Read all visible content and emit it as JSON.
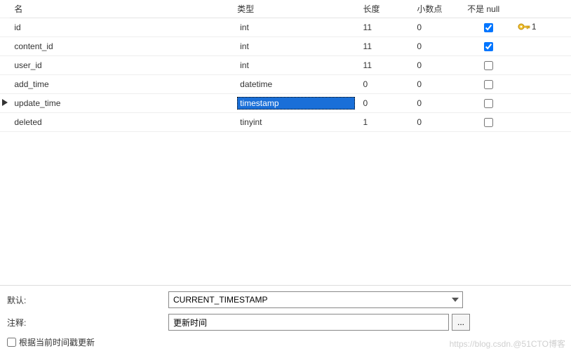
{
  "table": {
    "headers": {
      "name": "名",
      "type": "类型",
      "length": "长度",
      "decimals": "小数点",
      "notnull": "不是 null"
    },
    "rows": [
      {
        "name": "id",
        "type": "int",
        "length": "11",
        "decimals": "0",
        "notnull": true,
        "selected": false,
        "active": false,
        "pk": "1"
      },
      {
        "name": "content_id",
        "type": "int",
        "length": "11",
        "decimals": "0",
        "notnull": true,
        "selected": false,
        "active": false,
        "pk": ""
      },
      {
        "name": "user_id",
        "type": "int",
        "length": "11",
        "decimals": "0",
        "notnull": false,
        "selected": false,
        "active": false,
        "pk": ""
      },
      {
        "name": "add_time",
        "type": "datetime",
        "length": "0",
        "decimals": "0",
        "notnull": false,
        "selected": false,
        "active": false,
        "pk": ""
      },
      {
        "name": "update_time",
        "type": "timestamp",
        "length": "0",
        "decimals": "0",
        "notnull": false,
        "selected": true,
        "active": true,
        "pk": ""
      },
      {
        "name": "deleted",
        "type": "tinyint",
        "length": "1",
        "decimals": "0",
        "notnull": false,
        "selected": false,
        "active": false,
        "pk": ""
      }
    ]
  },
  "panel": {
    "default_label": "默认:",
    "default_value": "CURRENT_TIMESTAMP",
    "comment_label": "注释:",
    "comment_value": "更新时间",
    "more_btn": "...",
    "on_update_label": "根据当前时间戳更新",
    "on_update_checked": false
  },
  "watermark": "https://blog.csdn.@51CTO博客"
}
